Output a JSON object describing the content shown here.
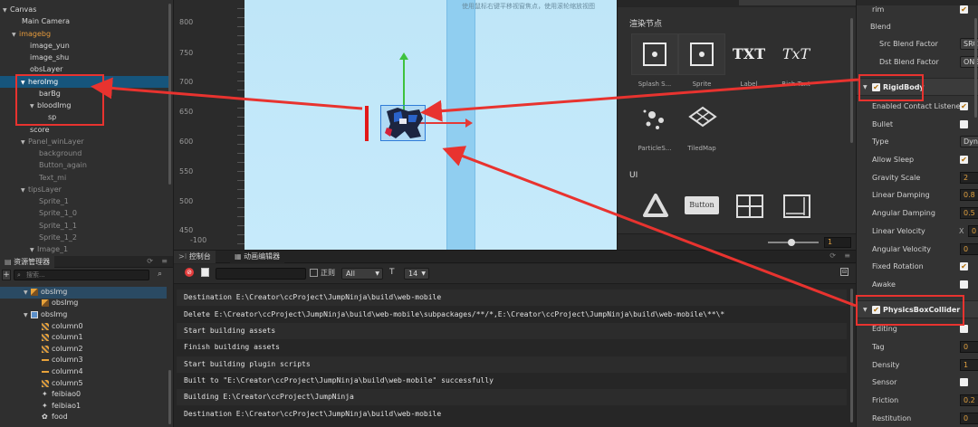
{
  "hierarchy": {
    "items": [
      {
        "label": "Canvas"
      },
      {
        "label": "Main Camera"
      },
      {
        "label": "imagebg"
      },
      {
        "label": "image_yun"
      },
      {
        "label": "image_shu"
      },
      {
        "label": "obsLayer"
      },
      {
        "label": "heroImg"
      },
      {
        "label": "barBg"
      },
      {
        "label": "bloodImg"
      },
      {
        "label": "sp"
      },
      {
        "label": "score"
      },
      {
        "label": "Panel_winLayer"
      },
      {
        "label": "background"
      },
      {
        "label": "Button_again"
      },
      {
        "label": "Text_mi"
      },
      {
        "label": "tipsLayer"
      },
      {
        "label": "Sprite_1"
      },
      {
        "label": "Sprite_1_0"
      },
      {
        "label": "Sprite_1_1"
      },
      {
        "label": "Sprite_1_2"
      },
      {
        "label": "Image_1"
      }
    ]
  },
  "assets": {
    "tab_label": "资源管理器",
    "search_placeholder": "搜索...",
    "items": [
      {
        "label": "obsImg"
      },
      {
        "label": "obsImg"
      },
      {
        "label": "obsImg"
      },
      {
        "label": "column0"
      },
      {
        "label": "column1"
      },
      {
        "label": "column2"
      },
      {
        "label": "column3"
      },
      {
        "label": "column4"
      },
      {
        "label": "column5"
      },
      {
        "label": "feibiao0"
      },
      {
        "label": "feibiao1"
      },
      {
        "label": "food"
      }
    ]
  },
  "scene": {
    "hint": "使用鼠标右键平移视窗焦点，使用滚轮缩放视图",
    "y_ticks": [
      "800",
      "750",
      "700",
      "650",
      "600",
      "550",
      "500",
      "450"
    ],
    "x_tick": "-100"
  },
  "node_library": {
    "render_section": "渲染节点",
    "ui_section": "UI",
    "render_items": [
      {
        "label": "Splash S..."
      },
      {
        "label": "Sprite"
      },
      {
        "label": "Label"
      },
      {
        "label": "Rich Text"
      },
      {
        "label": "ParticleS..."
      },
      {
        "label": "TiledMap"
      }
    ],
    "button_text": "Button",
    "zoom_value": "1"
  },
  "console": {
    "tab_console": "控制台",
    "tab_anim": "动画编辑器",
    "regex_label": "正则",
    "filter_value": "All",
    "font_size_value": "14",
    "lines": [
      "Destination E:\\Creator\\ccProject\\JumpNinja\\build\\web-mobile",
      "Delete E:\\Creator\\ccProject\\JumpNinja\\build\\web-mobile\\subpackages/**/*,E:\\Creator\\ccProject\\JumpNinja\\build\\web-mobile\\**\\*",
      "Start building assets",
      "Finish building assets",
      "Start building plugin scripts",
      "Built to \"E:\\Creator\\ccProject\\JumpNinja\\build\\web-mobile\" successfully",
      "Building E:\\Creator\\ccProject\\JumpNinja",
      "Destination E:\\Creator\\ccProject\\JumpNinja\\build\\web-mobile"
    ]
  },
  "inspector": {
    "trim_label": "rim",
    "blend_label": "Blend",
    "src_blend_label": "Src Blend Factor",
    "src_blend_value": "SRC",
    "dst_blend_label": "Dst Blend Factor",
    "dst_blend_value": "ONE",
    "rigidbody_title": "RigidBody",
    "rigidbody_props": [
      {
        "label": "Enabled Contact Listener"
      },
      {
        "label": "Bullet"
      },
      {
        "label": "Type",
        "value": "Dyn"
      },
      {
        "label": "Allow Sleep"
      },
      {
        "label": "Gravity Scale",
        "value": "2"
      },
      {
        "label": "Linear Damping",
        "value": "0.8"
      },
      {
        "label": "Angular Damping",
        "value": "0.5"
      },
      {
        "label": "Linear Velocity",
        "axis": "X",
        "value": "0"
      },
      {
        "label": "Angular Velocity",
        "value": "0"
      },
      {
        "label": "Fixed Rotation"
      },
      {
        "label": "Awake"
      }
    ],
    "collider_title": "PhysicsBoxCollider",
    "collider_props": [
      {
        "label": "Editing"
      },
      {
        "label": "Tag",
        "value": "0"
      },
      {
        "label": "Density",
        "value": "1"
      },
      {
        "label": "Sensor"
      },
      {
        "label": "Friction",
        "value": "0.2"
      },
      {
        "label": "Restitution",
        "value": "0"
      }
    ]
  },
  "colors": {
    "annotation": "#e8332f",
    "selection": "#16557c",
    "scene_sky": "#bfe6f8",
    "checkbox_tick": "#b06a00"
  }
}
